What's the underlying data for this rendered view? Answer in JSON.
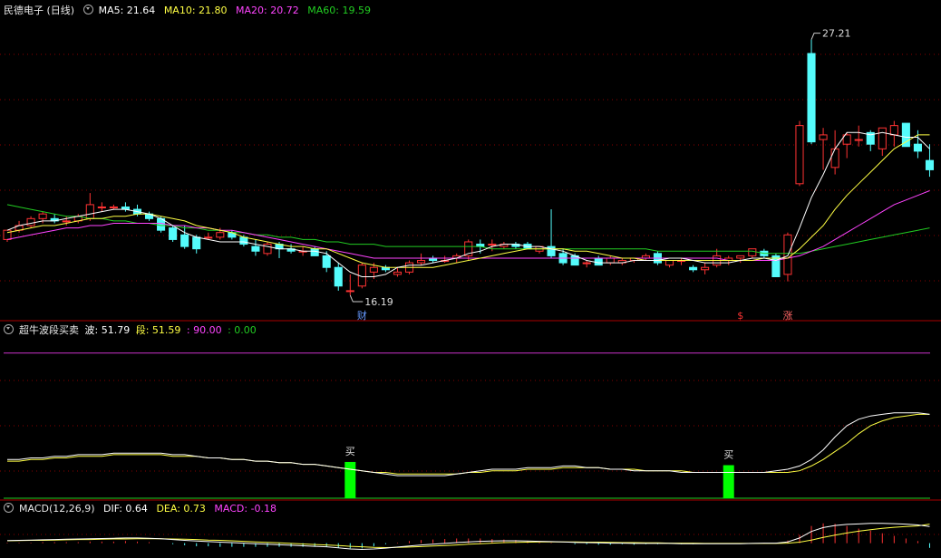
{
  "header": {
    "title": "民德电子 (日线)",
    "ma5": "MA5: 21.64",
    "ma10": "MA10: 21.80",
    "ma20": "MA20: 20.72",
    "ma60": "MA60: 19.59"
  },
  "indicator": {
    "title": "超牛波段买卖",
    "bo": "波: 51.79",
    "duan": "段: 51.59",
    "v1": ": 90.00",
    "v2": ": 0.00"
  },
  "macd": {
    "title": "MACD(12,26,9)",
    "dif": "DIF: 0.64",
    "dea": "DEA: 0.73",
    "macd": "MACD: -0.18"
  },
  "colors": {
    "up": "#ff3333",
    "down": "#54fcfc",
    "ma5": "#ffffff",
    "ma10": "#ffff44",
    "ma20": "#ff44ff",
    "ma60": "#22cc22",
    "grid": "#880000",
    "buy": "#00ff00",
    "level": "#cc33cc"
  },
  "chart_data": {
    "type": "candlestick",
    "price_axis": {
      "ymin": 15.5,
      "ymax": 28.2
    },
    "high_label": "27.21",
    "low_label": "16.19",
    "candles": [
      [
        18.6,
        19.0,
        18.5,
        19.0
      ],
      [
        19.0,
        19.4,
        18.9,
        19.2
      ],
      [
        19.2,
        19.6,
        19.1,
        19.5
      ],
      [
        19.5,
        19.8,
        19.3,
        19.7
      ],
      [
        19.5,
        19.7,
        19.3,
        19.4
      ],
      [
        19.4,
        19.6,
        19.2,
        19.4
      ],
      [
        19.4,
        19.7,
        19.3,
        19.6
      ],
      [
        19.5,
        20.6,
        19.4,
        20.1
      ],
      [
        20.0,
        20.2,
        19.8,
        20.0
      ],
      [
        20.0,
        20.1,
        19.9,
        20.0
      ],
      [
        20.0,
        20.2,
        19.8,
        19.9
      ],
      [
        19.9,
        20.1,
        19.6,
        19.7
      ],
      [
        19.7,
        19.8,
        19.4,
        19.5
      ],
      [
        19.5,
        19.6,
        18.9,
        19.0
      ],
      [
        19.1,
        19.2,
        18.5,
        18.6
      ],
      [
        18.8,
        19.2,
        18.2,
        18.3
      ],
      [
        18.7,
        18.8,
        18.0,
        18.2
      ],
      [
        18.7,
        18.9,
        18.6,
        18.7
      ],
      [
        18.7,
        19.1,
        18.6,
        18.9
      ],
      [
        18.9,
        19.0,
        18.6,
        18.7
      ],
      [
        18.7,
        18.8,
        18.3,
        18.4
      ],
      [
        18.3,
        18.6,
        17.9,
        18.1
      ],
      [
        18.0,
        18.5,
        17.9,
        18.4
      ],
      [
        18.4,
        18.5,
        17.8,
        18.2
      ],
      [
        18.2,
        18.4,
        18.0,
        18.1
      ],
      [
        18.1,
        18.3,
        17.9,
        18.1
      ],
      [
        18.2,
        18.3,
        17.9,
        17.9
      ],
      [
        17.9,
        18.1,
        17.2,
        17.4
      ],
      [
        17.4,
        17.6,
        16.4,
        16.6
      ],
      [
        16.4,
        17.1,
        16.2,
        16.4
      ],
      [
        16.6,
        17.6,
        16.5,
        17.5
      ],
      [
        17.2,
        17.6,
        16.9,
        17.4
      ],
      [
        17.4,
        17.5,
        17.2,
        17.3
      ],
      [
        17.1,
        17.4,
        17.0,
        17.2
      ],
      [
        17.2,
        17.7,
        17.1,
        17.6
      ],
      [
        17.6,
        18.0,
        17.5,
        17.7
      ],
      [
        17.8,
        17.9,
        17.6,
        17.7
      ],
      [
        17.7,
        17.9,
        17.6,
        17.7
      ],
      [
        17.8,
        18.0,
        17.6,
        17.9
      ],
      [
        17.9,
        18.6,
        17.7,
        18.5
      ],
      [
        18.4,
        18.6,
        18.0,
        18.3
      ],
      [
        18.4,
        18.6,
        18.1,
        18.4
      ],
      [
        18.3,
        18.5,
        18.2,
        18.4
      ],
      [
        18.4,
        18.5,
        18.2,
        18.3
      ],
      [
        18.4,
        18.5,
        18.2,
        18.2
      ],
      [
        18.1,
        18.3,
        18.0,
        18.3
      ],
      [
        18.3,
        19.9,
        17.8,
        17.9
      ],
      [
        18.0,
        18.2,
        17.5,
        17.6
      ],
      [
        17.9,
        18.0,
        17.5,
        17.5
      ],
      [
        17.6,
        17.7,
        17.4,
        17.6
      ],
      [
        17.8,
        17.9,
        17.5,
        17.5
      ],
      [
        17.6,
        17.9,
        17.5,
        17.8
      ],
      [
        17.6,
        17.8,
        17.5,
        17.7
      ],
      [
        17.7,
        17.8,
        17.6,
        17.8
      ],
      [
        17.8,
        18.0,
        17.7,
        17.9
      ],
      [
        18.0,
        18.1,
        17.5,
        17.6
      ],
      [
        17.5,
        17.7,
        17.4,
        17.7
      ],
      [
        17.7,
        17.8,
        17.5,
        17.7
      ],
      [
        17.4,
        17.5,
        17.2,
        17.3
      ],
      [
        17.3,
        17.6,
        17.1,
        17.4
      ],
      [
        17.5,
        18.2,
        17.4,
        17.9
      ],
      [
        17.7,
        17.9,
        17.5,
        17.8
      ],
      [
        17.8,
        17.9,
        17.6,
        17.9
      ],
      [
        17.9,
        18.2,
        17.8,
        18.2
      ],
      [
        18.1,
        18.2,
        17.8,
        17.9
      ],
      [
        17.9,
        18.0,
        17.5,
        17.0
      ],
      [
        17.1,
        18.9,
        16.8,
        18.8
      ],
      [
        21.0,
        23.7,
        20.9,
        23.5
      ],
      [
        26.6,
        27.2,
        22.7,
        22.8
      ],
      [
        22.9,
        23.4,
        21.6,
        23.1
      ],
      [
        21.7,
        23.3,
        21.4,
        22.5
      ],
      [
        22.7,
        23.2,
        22.1,
        23.1
      ],
      [
        22.9,
        23.5,
        22.6,
        22.9
      ],
      [
        23.2,
        23.3,
        22.4,
        22.7
      ],
      [
        22.5,
        23.4,
        22.2,
        23.4
      ],
      [
        23.1,
        23.7,
        22.6,
        23.5
      ],
      [
        23.6,
        23.2,
        22.6,
        22.6
      ],
      [
        22.7,
        23.3,
        22.1,
        22.4
      ],
      [
        22.0,
        22.7,
        21.3,
        21.6
      ]
    ],
    "ma5": [
      19.0,
      19.2,
      19.3,
      19.4,
      19.4,
      19.5,
      19.6,
      19.7,
      19.8,
      19.9,
      19.9,
      19.8,
      19.7,
      19.5,
      19.2,
      18.9,
      18.7,
      18.6,
      18.5,
      18.5,
      18.5,
      18.4,
      18.3,
      18.2,
      18.2,
      18.1,
      18.1,
      18.0,
      17.6,
      17.2,
      17.0,
      17.0,
      17.1,
      17.4,
      17.5,
      17.5,
      17.6,
      17.7,
      17.8,
      18.0,
      18.1,
      18.3,
      18.4,
      18.4,
      18.3,
      18.3,
      18.2,
      18.1,
      17.9,
      17.7,
      17.6,
      17.6,
      17.6,
      17.7,
      17.7,
      17.7,
      17.8,
      17.8,
      17.7,
      17.6,
      17.6,
      17.6,
      17.7,
      17.8,
      17.8,
      17.7,
      17.9,
      19.1,
      20.4,
      21.4,
      22.5,
      23.2,
      23.2,
      23.1,
      23.2,
      23.1,
      23.0,
      23.0,
      22.5
    ],
    "ma10": [
      18.9,
      19.0,
      19.1,
      19.2,
      19.2,
      19.3,
      19.4,
      19.5,
      19.5,
      19.6,
      19.6,
      19.7,
      19.7,
      19.6,
      19.5,
      19.4,
      19.2,
      19.1,
      19.0,
      18.9,
      18.7,
      18.6,
      18.5,
      18.4,
      18.3,
      18.3,
      18.2,
      18.2,
      18.0,
      17.8,
      17.6,
      17.5,
      17.4,
      17.4,
      17.4,
      17.4,
      17.4,
      17.5,
      17.6,
      17.7,
      17.8,
      17.9,
      18.0,
      18.1,
      18.2,
      18.2,
      18.2,
      18.2,
      18.1,
      18.1,
      18.0,
      17.9,
      17.8,
      17.8,
      17.7,
      17.7,
      17.7,
      17.7,
      17.7,
      17.7,
      17.7,
      17.7,
      17.7,
      17.7,
      17.8,
      17.8,
      17.8,
      18.2,
      18.7,
      19.2,
      19.9,
      20.5,
      21.0,
      21.5,
      22.0,
      22.5,
      22.8,
      23.1,
      23.1
    ],
    "ma20": [
      18.6,
      18.7,
      18.8,
      18.9,
      19.0,
      19.1,
      19.1,
      19.2,
      19.2,
      19.3,
      19.3,
      19.3,
      19.3,
      19.3,
      19.2,
      19.2,
      19.1,
      19.1,
      19.0,
      19.0,
      18.9,
      18.8,
      18.7,
      18.6,
      18.5,
      18.4,
      18.3,
      18.2,
      18.1,
      18.0,
      17.9,
      17.8,
      17.8,
      17.8,
      17.8,
      17.8,
      17.8,
      17.8,
      17.8,
      17.8,
      17.8,
      17.8,
      17.8,
      17.8,
      17.8,
      17.8,
      17.8,
      17.8,
      17.8,
      17.8,
      17.8,
      17.8,
      17.8,
      17.8,
      17.8,
      17.8,
      17.8,
      17.8,
      17.8,
      17.8,
      17.8,
      17.7,
      17.7,
      17.7,
      17.7,
      17.7,
      17.8,
      17.9,
      18.1,
      18.3,
      18.6,
      18.9,
      19.2,
      19.5,
      19.8,
      20.1,
      20.3,
      20.5,
      20.7
    ],
    "ma60": [
      20.1,
      20.0,
      19.9,
      19.8,
      19.7,
      19.6,
      19.6,
      19.5,
      19.5,
      19.4,
      19.4,
      19.3,
      19.3,
      19.2,
      19.2,
      19.1,
      19.1,
      19.0,
      19.0,
      18.9,
      18.9,
      18.8,
      18.8,
      18.7,
      18.7,
      18.6,
      18.6,
      18.5,
      18.5,
      18.4,
      18.4,
      18.4,
      18.3,
      18.3,
      18.3,
      18.3,
      18.3,
      18.3,
      18.3,
      18.3,
      18.3,
      18.2,
      18.2,
      18.2,
      18.2,
      18.2,
      18.2,
      18.2,
      18.2,
      18.2,
      18.2,
      18.2,
      18.2,
      18.2,
      18.2,
      18.1,
      18.1,
      18.1,
      18.1,
      18.1,
      18.1,
      18.1,
      18.1,
      18.1,
      18.0,
      18.0,
      18.0,
      18.0,
      18.1,
      18.2,
      18.3,
      18.4,
      18.5,
      18.6,
      18.7,
      18.8,
      18.9,
      19.0,
      19.1
    ],
    "markers": [
      {
        "index": 30,
        "label": "财",
        "color": "#6699ff"
      },
      {
        "index": 62,
        "label": "$",
        "color": "#ff3333"
      },
      {
        "index": 66,
        "label": "涨",
        "color": "#ff6666"
      }
    ],
    "indicator_axis": {
      "ymin": 0,
      "ymax": 100
    },
    "bo": [
      24,
      24,
      25,
      25,
      26,
      26,
      27,
      27,
      27,
      28,
      28,
      28,
      28,
      28,
      27,
      27,
      26,
      25,
      25,
      24,
      24,
      23,
      23,
      22,
      22,
      21,
      21,
      20,
      19,
      18,
      17,
      16,
      15,
      14,
      14,
      14,
      14,
      14,
      15,
      16,
      17,
      18,
      18,
      18,
      19,
      19,
      19,
      20,
      20,
      19,
      19,
      18,
      18,
      17,
      17,
      17,
      17,
      16,
      16,
      16,
      16,
      16,
      16,
      16,
      16,
      17,
      18,
      20,
      24,
      30,
      38,
      45,
      49,
      51,
      52,
      53,
      53,
      53,
      52
    ],
    "duan": [
      23,
      23,
      24,
      24,
      25,
      25,
      26,
      26,
      26,
      27,
      27,
      27,
      27,
      27,
      26,
      26,
      26,
      25,
      25,
      24,
      24,
      23,
      23,
      22,
      22,
      21,
      21,
      20,
      19,
      18,
      17,
      16,
      16,
      15,
      15,
      15,
      15,
      15,
      15,
      16,
      16,
      17,
      17,
      17,
      18,
      18,
      18,
      19,
      19,
      19,
      19,
      18,
      18,
      18,
      17,
      17,
      17,
      17,
      16,
      16,
      16,
      16,
      16,
      16,
      16,
      16,
      16,
      17,
      20,
      24,
      29,
      34,
      40,
      45,
      48,
      50,
      51,
      52,
      52
    ],
    "level_line": 90,
    "buy_signals": [
      {
        "index": 29,
        "label": "买"
      },
      {
        "index": 61,
        "label": "买"
      }
    ],
    "macd_axis": {
      "ymin": -0.5,
      "ymax": 1.1
    },
    "dif": [
      0.1,
      0.11,
      0.12,
      0.13,
      0.14,
      0.15,
      0.16,
      0.17,
      0.18,
      0.19,
      0.2,
      0.2,
      0.19,
      0.17,
      0.14,
      0.11,
      0.08,
      0.06,
      0.04,
      0.02,
      0.0,
      -0.02,
      -0.04,
      -0.06,
      -0.08,
      -0.1,
      -0.12,
      -0.14,
      -0.18,
      -0.22,
      -0.24,
      -0.22,
      -0.19,
      -0.15,
      -0.11,
      -0.07,
      -0.04,
      -0.01,
      0.02,
      0.05,
      0.07,
      0.08,
      0.09,
      0.09,
      0.08,
      0.07,
      0.06,
      0.05,
      0.03,
      0.02,
      0.01,
      0.0,
      0.0,
      -0.01,
      -0.01,
      -0.01,
      -0.01,
      -0.02,
      -0.02,
      -0.02,
      -0.02,
      -0.02,
      -0.02,
      -0.01,
      0.0,
      0.0,
      0.05,
      0.2,
      0.45,
      0.6,
      0.68,
      0.72,
      0.74,
      0.76,
      0.76,
      0.75,
      0.73,
      0.7,
      0.64
    ],
    "dea": [
      0.09,
      0.1,
      0.11,
      0.11,
      0.12,
      0.13,
      0.14,
      0.14,
      0.15,
      0.16,
      0.16,
      0.17,
      0.17,
      0.17,
      0.16,
      0.15,
      0.14,
      0.12,
      0.11,
      0.09,
      0.07,
      0.05,
      0.03,
      0.01,
      -0.01,
      -0.03,
      -0.05,
      -0.07,
      -0.09,
      -0.12,
      -0.14,
      -0.16,
      -0.17,
      -0.16,
      -0.15,
      -0.13,
      -0.11,
      -0.09,
      -0.07,
      -0.04,
      -0.02,
      0.0,
      0.02,
      0.03,
      0.04,
      0.05,
      0.05,
      0.05,
      0.05,
      0.04,
      0.04,
      0.03,
      0.02,
      0.02,
      0.01,
      0.01,
      0.0,
      0.0,
      0.0,
      -0.01,
      -0.01,
      -0.01,
      -0.01,
      -0.01,
      -0.01,
      -0.01,
      0.0,
      0.04,
      0.12,
      0.22,
      0.31,
      0.39,
      0.46,
      0.52,
      0.57,
      0.61,
      0.64,
      0.66,
      0.73
    ]
  }
}
